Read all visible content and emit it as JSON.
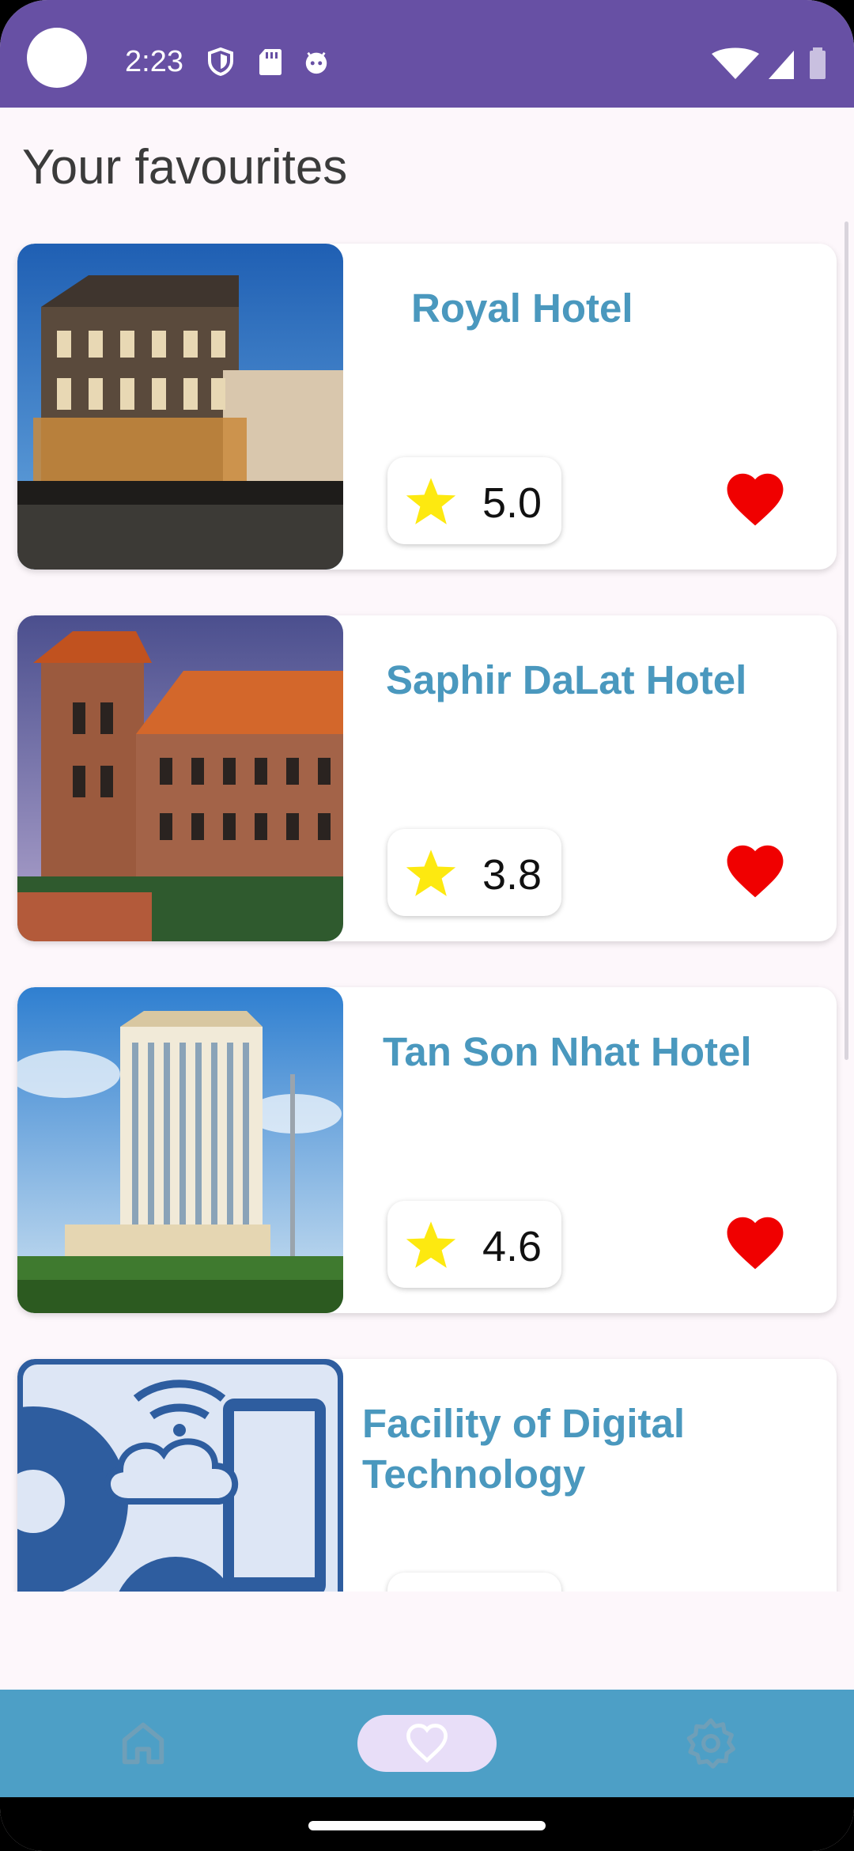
{
  "status_bar": {
    "time": "2:23",
    "icons_left": [
      "shield-icon",
      "sd-card-icon",
      "android-face-icon"
    ],
    "icons_right": [
      "wifi-icon",
      "signal-icon",
      "battery-icon"
    ]
  },
  "page": {
    "title": "Your favourites"
  },
  "hotels": [
    {
      "name": "Royal Hotel",
      "rating": "5.0",
      "favourite": true
    },
    {
      "name": "Saphir DaLat Hotel",
      "rating": "3.8",
      "favourite": true
    },
    {
      "name": "Tan Son Nhat Hotel",
      "rating": "4.6",
      "favourite": true
    },
    {
      "name": "Facility of Digital Technology",
      "rating": "",
      "favourite": true
    }
  ],
  "bottom_nav": {
    "items": [
      "home-icon",
      "heart-icon",
      "gear-icon"
    ],
    "selected": "heart-icon"
  },
  "colors": {
    "status_bar": "#6750a4",
    "accent_text": "#4a98be",
    "bottom_nav": "#4d9fc6",
    "heart": "#f00000",
    "star": "#fde910"
  }
}
